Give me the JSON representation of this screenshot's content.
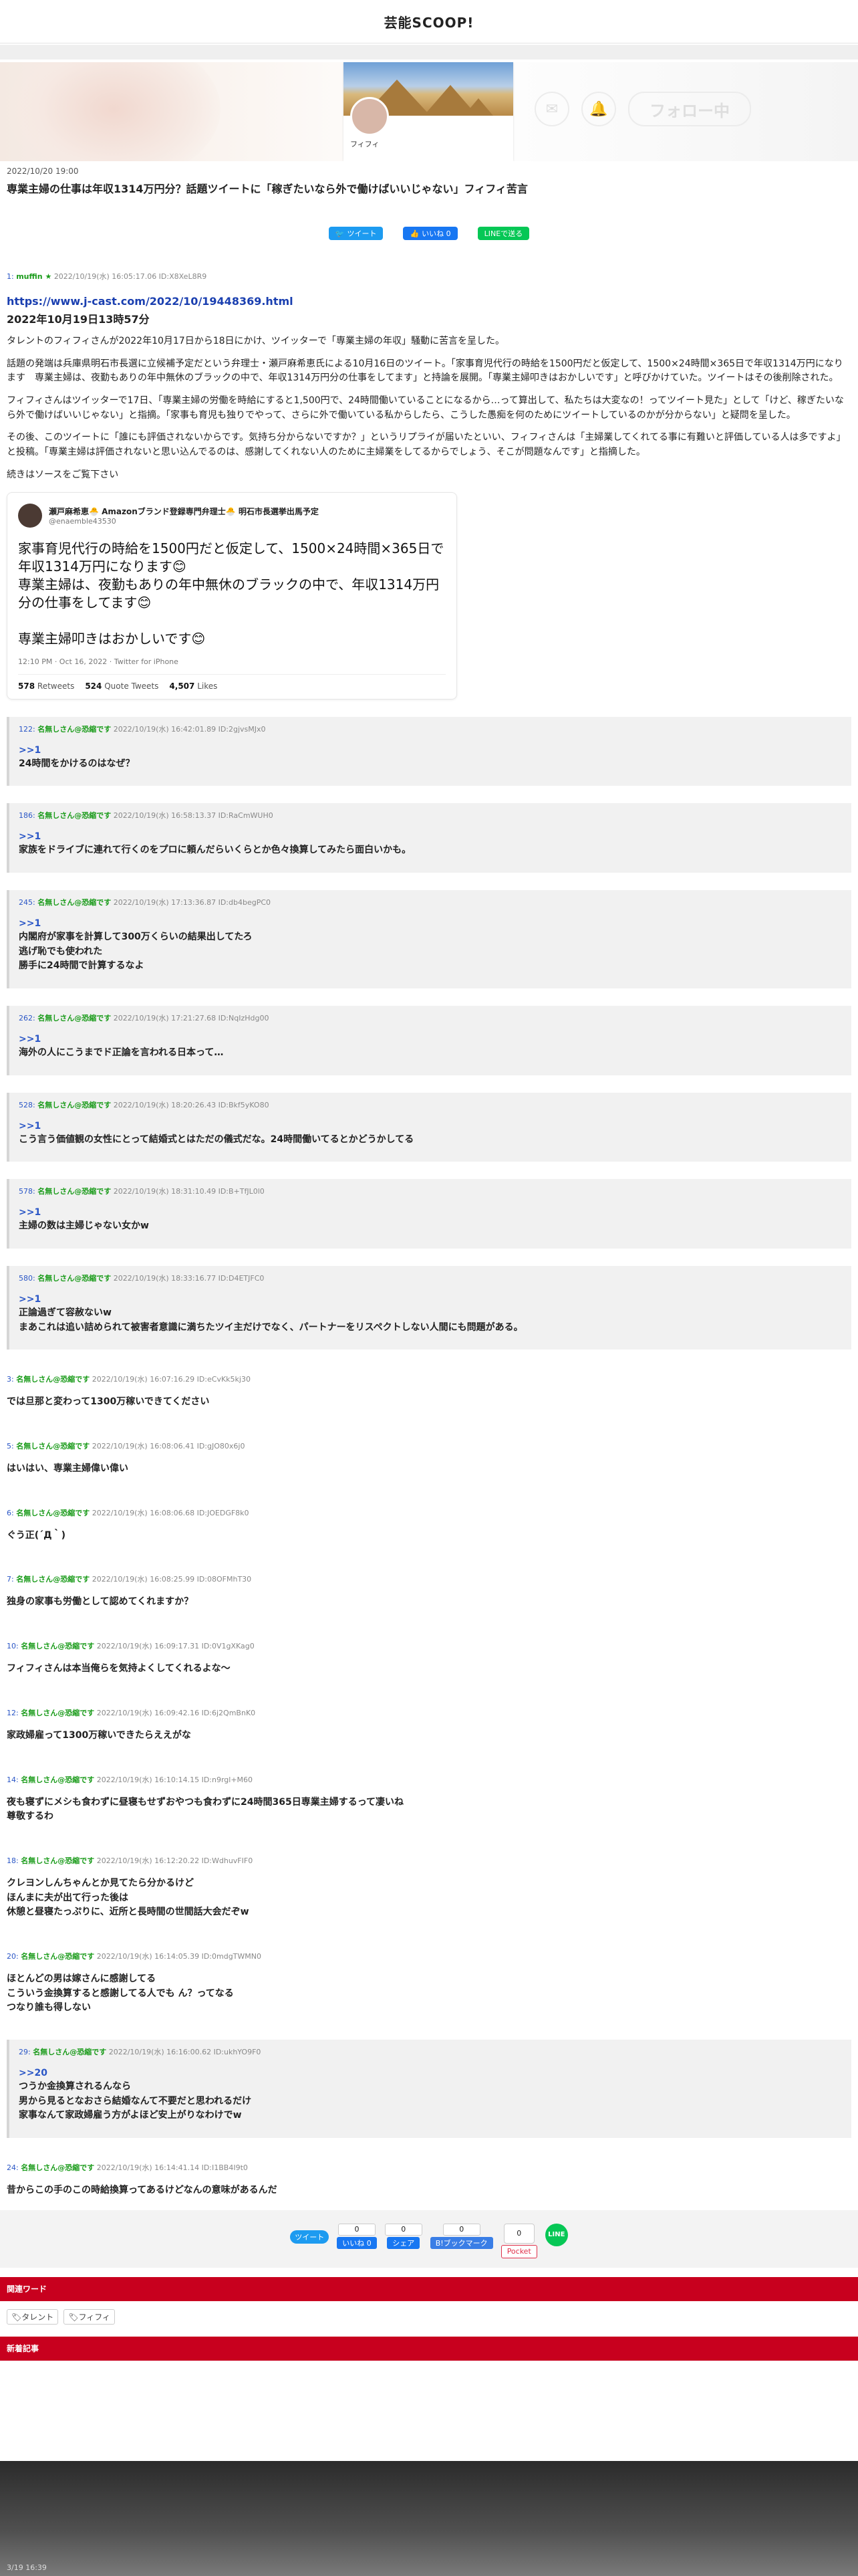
{
  "site": {
    "title": "芸能SCOOP!"
  },
  "hero": {
    "profile_name": "フィフィ",
    "follow_label": "フォロー中"
  },
  "article": {
    "date": "2022/10/20 19:00",
    "title": "専業主婦の仕事は年収1314万円分？話題ツイートに「稼ぎたいなら外で働けばいいじゃない」フィフィ苦言"
  },
  "share_top": {
    "twitter": "ツイート",
    "facebook": "いいね 0",
    "line": "LINEで送る"
  },
  "op": {
    "num": "1:",
    "name": "muffin ★",
    "meta": "2022/10/19(水) 16:05:17.06 ID:X8XeL8R9",
    "link": "https://www.j-cast.com/2022/10/19448369.html",
    "date_line": "2022年10月19日13時57分",
    "p1": "タレントのフィフィさんが2022年10月17日から18日にかけ、ツイッターで「専業主婦の年収」騒動に苦言を呈した。",
    "p2": "話題の発端は兵庫県明石市長選に立候補予定だという弁理士・瀬戸麻希恵氏による10月16日のツイート。「家事育児代行の時給を1500円だと仮定して、1500×24時間×365日で年収1314万円になります　専業主婦は、夜勤もありの年中無休のブラックの中で、年収1314万円分の仕事をしてます」と持論を展開。「専業主婦叩きはおかしいです」と呼びかけていた。ツイートはその後削除された。",
    "p3": "フィフィさんはツイッターで17日、「専業主婦の労働を時給にすると1,500円で、24時間働いていることになるから…って算出して、私たちは大変なの！ってツイート見た」として「けど、稼ぎたいなら外で働けばいいじゃない」と指摘。「家事も育児も独りでやって、さらに外で働いている私からしたら、こうした愚痴を何のためにツイートしているのかが分からない」と疑問を呈した。",
    "p4": "その後、このツイートに「誰にも評価されないからです。気持ち分からないですか？」というリプライが届いたといい、フィフィさんは「主婦業してくれてる事に有難いと評価している人は多ですよ」と投稿。「専業主婦は評価されないと思い込んでるのは、感謝してくれない人のために主婦業をしてるからでしょう、そこが問題なんです」と指摘した。",
    "more": "続きはソースをご覧下さい"
  },
  "tweet": {
    "name": "瀬戸麻希恵🐣 Amazonブランド登録専門弁理士🐣 明石市長選挙出馬予定",
    "handle": "@enaemble43530",
    "body": "家事育児代行の時給を1500円だと仮定して、1500×24時間×365日で年収1314万円になります😊\n専業主婦は、夜勤もありの年中無休のブラックの中で、年収1314万円分の仕事をしてます😊\n\n専業主婦叩きはおかしいです😊",
    "time": "12:10 PM · Oct 16, 2022 · Twitter for iPhone",
    "retweets_n": "578",
    "retweets_l": "Retweets",
    "quotes_n": "524",
    "quotes_l": "Quote Tweets",
    "likes_n": "4,507",
    "likes_l": "Likes"
  },
  "replies": [
    {
      "boxed": true,
      "num": "122:",
      "name": "名無しさん@恐縮です",
      "meta": "2022/10/19(水) 16:42:01.89 ID:2gjvsMJx0",
      "anchor": ">>1",
      "body": "24時間をかけるのはなぜ？"
    },
    {
      "boxed": true,
      "num": "186:",
      "name": "名無しさん@恐縮です",
      "meta": "2022/10/19(水) 16:58:13.37 ID:RaCmWUH0",
      "anchor": ">>1",
      "body": "家族をドライブに連れて行くのをプロに頼んだらいくらとか色々換算してみたら面白いかも。"
    },
    {
      "boxed": true,
      "num": "245:",
      "name": "名無しさん@恐縮です",
      "meta": "2022/10/19(水) 17:13:36.87 ID:db4begPC0",
      "anchor": ">>1",
      "body": "内閣府が家事を計算して300万くらいの結果出してたろ\n逃げ恥でも使われた\n勝手に24時間で計算するなよ"
    },
    {
      "boxed": true,
      "num": "262:",
      "name": "名無しさん@恐縮です",
      "meta": "2022/10/19(水) 17:21:27.68 ID:NqIzHdg00",
      "anchor": ">>1",
      "body": "海外の人にこうまでド正論を言われる日本って…"
    },
    {
      "boxed": true,
      "num": "528:",
      "name": "名無しさん@恐縮です",
      "meta": "2022/10/19(水) 18:20:26.43 ID:Bkf5yKO80",
      "anchor": ">>1",
      "body": "こう言う価値観の女性にとって結婚式とはただの儀式だな。24時間働いてるとかどうかしてる"
    },
    {
      "boxed": true,
      "num": "578:",
      "name": "名無しさん@恐縮です",
      "meta": "2022/10/19(水) 18:31:10.49 ID:B+TfJL0l0",
      "anchor": ">>1",
      "body": "主婦の数は主婦じゃない女かw"
    },
    {
      "boxed": true,
      "num": "580:",
      "name": "名無しさん@恐縮です",
      "meta": "2022/10/19(水) 18:33:16.77 ID:D4ETJFC0",
      "anchor": ">>1",
      "body": "正論過ぎて容赦ないw\nまあこれは追い詰められて被害者意識に満ちたツイ主だけでなく、パートナーをリスペクトしない人間にも問題がある。"
    },
    {
      "boxed": false,
      "num": "3:",
      "name": "名無しさん@恐縮です",
      "meta": "2022/10/19(水) 16:07:16.29 ID:eCvKk5kj30",
      "anchor": "",
      "body": "では旦那と変わって1300万稼いできてください"
    },
    {
      "boxed": false,
      "num": "5:",
      "name": "名無しさん@恐縮です",
      "meta": "2022/10/19(水) 16:08:06.41 ID:gJO80x6j0",
      "anchor": "",
      "body": "はいはい、専業主婦偉い偉い"
    },
    {
      "boxed": false,
      "num": "6:",
      "name": "名無しさん@恐縮です",
      "meta": "2022/10/19(水) 16:08:06.68 ID:JOEDGF8k0",
      "anchor": "",
      "body": "ぐう正(´Д｀)"
    },
    {
      "boxed": false,
      "num": "7:",
      "name": "名無しさん@恐縮です",
      "meta": "2022/10/19(水) 16:08:25.99 ID:08OFMhT30",
      "anchor": "",
      "body": "独身の家事も労働として認めてくれますか？"
    },
    {
      "boxed": false,
      "num": "10:",
      "name": "名無しさん@恐縮です",
      "meta": "2022/10/19(水) 16:09:17.31 ID:0V1gXKag0",
      "anchor": "",
      "body": "フィフィさんは本当俺らを気持よくしてくれるよな〜"
    },
    {
      "boxed": false,
      "num": "12:",
      "name": "名無しさん@恐縮です",
      "meta": "2022/10/19(水) 16:09:42.16 ID:6j2QmBnK0",
      "anchor": "",
      "body": "家政婦雇って1300万稼いできたらええがな"
    },
    {
      "boxed": false,
      "num": "14:",
      "name": "名無しさん@恐縮です",
      "meta": "2022/10/19(水) 16:10:14.15 ID:n9rgl+M60",
      "anchor": "",
      "body": "夜も寝ずにメシも食わずに昼寝もせずおやつも食わずに24時間365日専業主婦するって凄いね\n尊敬するわ"
    },
    {
      "boxed": false,
      "num": "18:",
      "name": "名無しさん@恐縮です",
      "meta": "2022/10/19(水) 16:12:20.22 ID:WdhuvFIF0",
      "anchor": "",
      "body": "クレヨンしんちゃんとか見てたら分かるけど\nほんまに夫が出て行った後は\n休憩と昼寝たっぷりに、近所と長時間の世間話大会だぞw"
    },
    {
      "boxed": false,
      "num": "20:",
      "name": "名無しさん@恐縮です",
      "meta": "2022/10/19(水) 16:14:05.39 ID:0mdgTWMN0",
      "anchor": "",
      "body": "ほとんどの男は嫁さんに感謝してる\nこういう金換算すると感謝してる人でも ん？ってなる\nつなり誰も得しない"
    },
    {
      "boxed": true,
      "num": "29:",
      "name": "名無しさん@恐縮です",
      "meta": "2022/10/19(水) 16:16:00.62 ID:ukhYO9F0",
      "anchor": ">>20",
      "body": "つうか金換算されるんなら\n男から見るとなおさら結婚なんて不要だと思われるだけ\n家事なんて家政婦雇う方がよほど安上がりなわけでw"
    },
    {
      "boxed": false,
      "num": "24:",
      "name": "名無しさん@恐縮です",
      "meta": "2022/10/19(水) 16:14:41.14 ID:I1BB4I9t0",
      "anchor": "",
      "body": "昔からこの手のこの時給換算ってあるけどなんの意味があるんだ"
    }
  ],
  "share_bottom": {
    "twitter": "ツイート",
    "fb_like_count": "0",
    "fb_like": "いいね 0",
    "fb_share_count": "0",
    "fb_share": "シェア",
    "hatena_count": "0",
    "hatena": "B!ブックマーク",
    "pocket_count": "0",
    "pocket": "Pocket",
    "line": "LINE"
  },
  "related": {
    "heading": "関連ワード",
    "tags": [
      "タレント",
      "フィフィ"
    ]
  },
  "new_articles": {
    "heading": "新着記事"
  },
  "footer": {
    "date": "3/19 16:39"
  }
}
